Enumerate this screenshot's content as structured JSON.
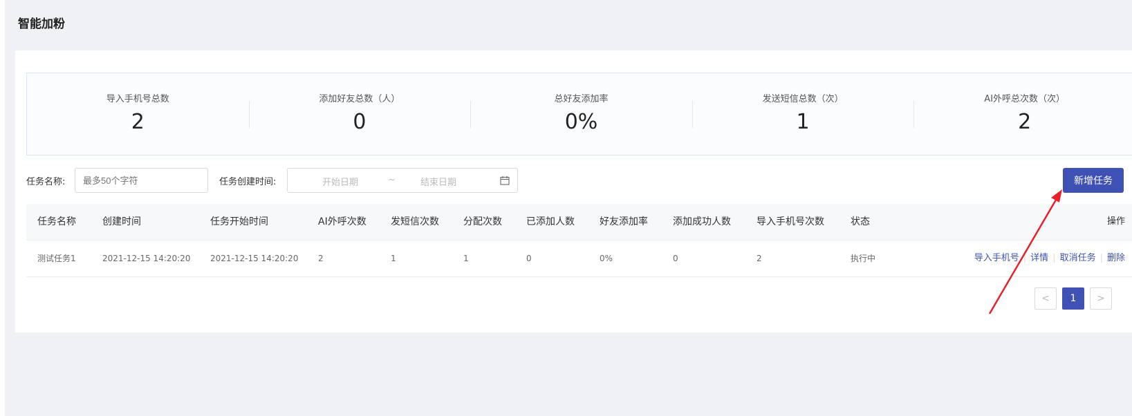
{
  "page_title": "智能加粉",
  "stats": [
    {
      "label": "导入手机号总数",
      "value": "2"
    },
    {
      "label": "添加好友总数（人）",
      "value": "0"
    },
    {
      "label": "总好友添加率",
      "value": "0%"
    },
    {
      "label": "发送短信总数（次）",
      "value": "1"
    },
    {
      "label": "AI外呼总次数（次）",
      "value": "2"
    }
  ],
  "filters": {
    "task_name_label": "任务名称:",
    "task_name_placeholder": "最多50个字符",
    "created_time_label": "任务创建时间:",
    "start_placeholder": "开始日期",
    "range_separator": "~",
    "end_placeholder": "结束日期"
  },
  "add_button": "新增任务",
  "table": {
    "headers": [
      "任务名称",
      "创建时间",
      "任务开始时间",
      "AI外呼次数",
      "发短信次数",
      "分配次数",
      "已添加人数",
      "好友添加率",
      "添加成功人数",
      "导入手机号次数",
      "状态",
      "操作"
    ],
    "rows": [
      {
        "cells": [
          "测试任务1",
          "2021-12-15 14:20:20",
          "2021-12-15 14:20:20",
          "2",
          "1",
          "1",
          "0",
          "0%",
          "0",
          "2",
          "执行中"
        ],
        "actions": [
          "导入手机号",
          "详情",
          "取消任务",
          "删除"
        ]
      }
    ]
  },
  "pagination": {
    "prev": "<",
    "current": "1",
    "next": ">"
  },
  "colors": {
    "primary": "#3f51b5",
    "annotation_arrow": "#e8202a"
  }
}
